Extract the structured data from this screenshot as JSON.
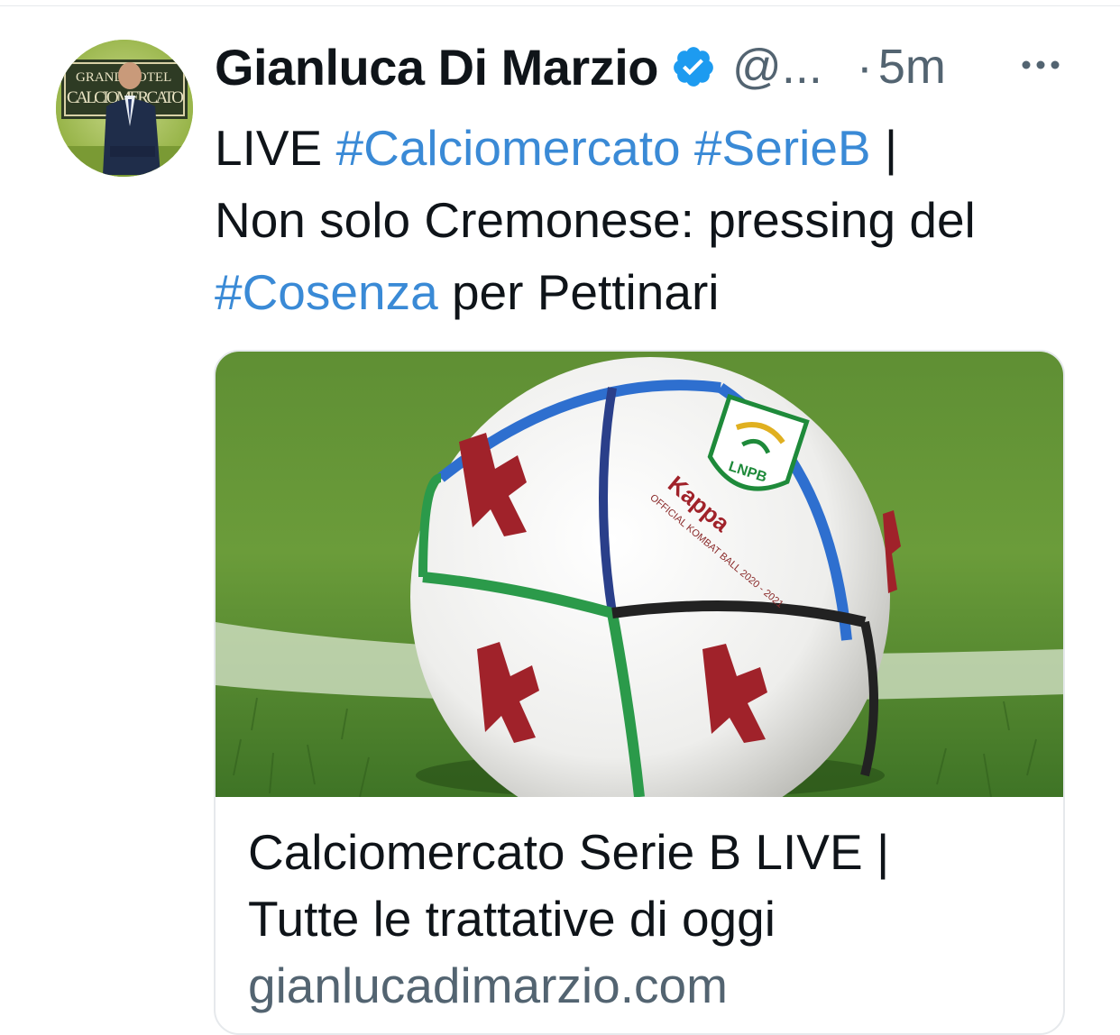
{
  "tweet": {
    "display_name": "Gianluca Di Marzio",
    "handle": "@...",
    "separator": "·",
    "time": "5m",
    "line1_prefix": "LIVE ",
    "line1_tag1": "#Calciomercato",
    "line1_space": " ",
    "line1_tag2": "#SerieB",
    "line1_suffix": " |",
    "line2": "Non solo Cremonese: pressing del",
    "line3_tag": "#Cosenza",
    "line3_suffix": " per Pettinari"
  },
  "avatar": {
    "sign_line1": "GRAND HOTEL",
    "sign_line2": "CALCIOMERCATO"
  },
  "card": {
    "title_line1": "Calciomercato Serie B LIVE |",
    "title_line2": "Tutte le trattative di oggi",
    "domain": "gianlucadimarzio.com",
    "ball_brand": "Kappa",
    "ball_text": "OFFICIAL KOMBAT BALL 2020 - 2021",
    "badge_text": "LNPB"
  },
  "colors": {
    "hashtag": "#3a8ad6",
    "secondary": "#536471",
    "verified": "#1d9bf0",
    "grass": "#4f8a2e"
  },
  "icons": {
    "verified": "verified-badge-icon",
    "more": "more-horizontal-icon"
  }
}
